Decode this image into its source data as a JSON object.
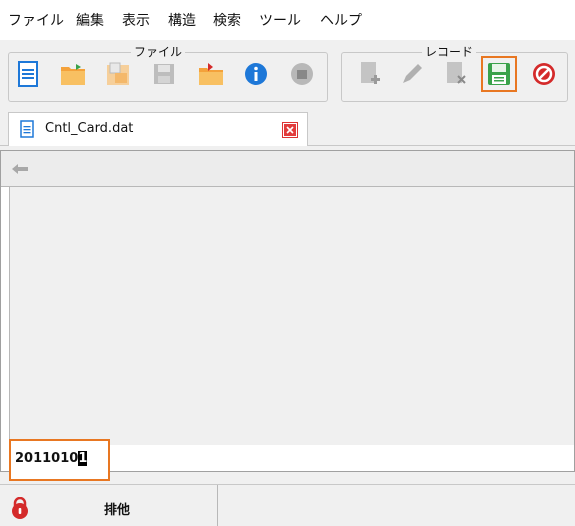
{
  "menu": [
    "ファイル",
    "編集",
    "表示",
    "構造",
    "検索",
    "ツール",
    "ヘルプ"
  ],
  "toolbar": {
    "file_group_label": "ファイル",
    "record_group_label": "レコード"
  },
  "tab": {
    "label": "Cntl_Card.dat"
  },
  "input": {
    "value_main": "2011010",
    "value_cursor": "1"
  },
  "status": {
    "text": "排他"
  },
  "colors": {
    "highlight": "#e87722",
    "accent_blue": "#1e78d8",
    "folder": "#f4a23b",
    "save_green": "#3aa24a",
    "cancel_red": "#d42a2a"
  }
}
